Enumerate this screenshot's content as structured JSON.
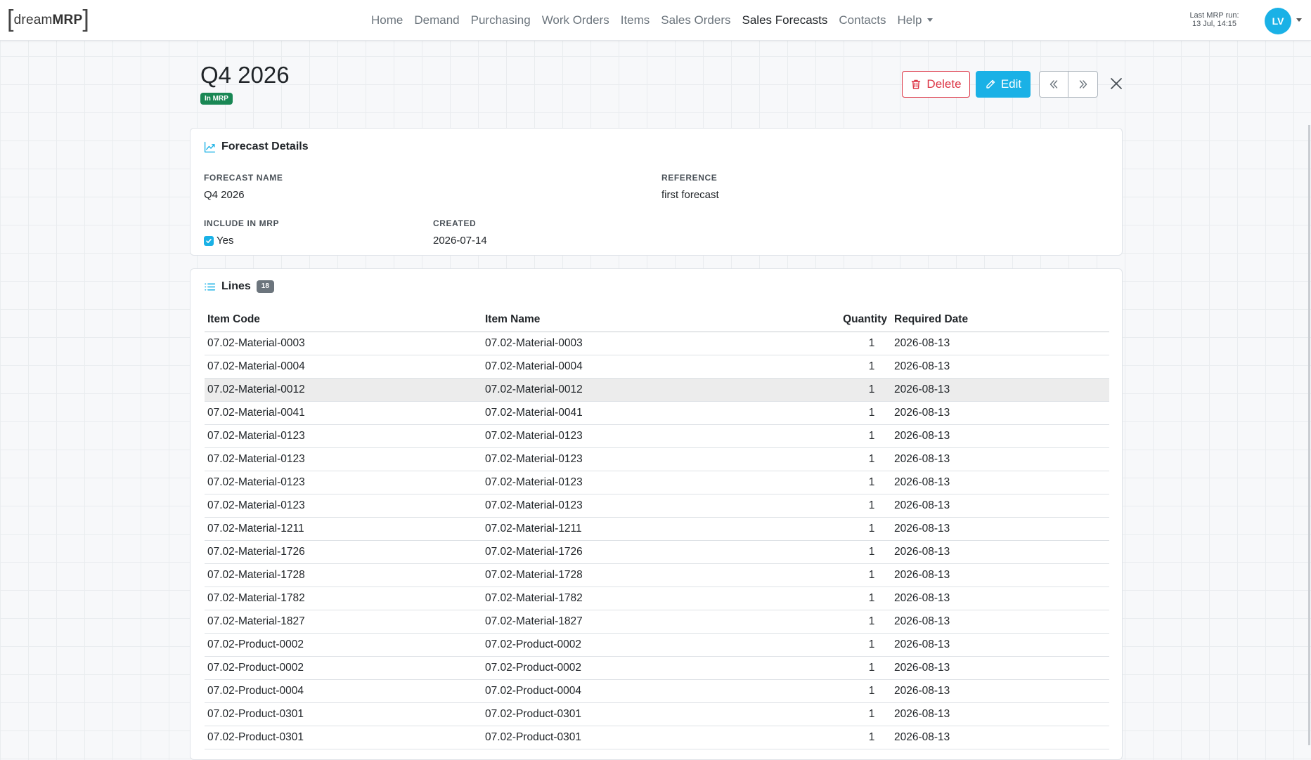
{
  "brand": {
    "left_bracket": "[",
    "light": "dream",
    "bold": "MRP",
    "right_bracket": "]"
  },
  "nav": {
    "links": [
      {
        "label": "Home",
        "active": false
      },
      {
        "label": "Demand",
        "active": false
      },
      {
        "label": "Purchasing",
        "active": false
      },
      {
        "label": "Work Orders",
        "active": false
      },
      {
        "label": "Items",
        "active": false
      },
      {
        "label": "Sales Orders",
        "active": false
      },
      {
        "label": "Sales Forecasts",
        "active": true
      },
      {
        "label": "Contacts",
        "active": false
      },
      {
        "label": "Help",
        "active": false
      }
    ],
    "last_mrp_label": "Last MRP run:",
    "last_mrp_value": "13 Jul, 14:15",
    "avatar_initials": "LV"
  },
  "header": {
    "title": "Q4 2026",
    "badge": "In MRP",
    "delete_label": "Delete",
    "edit_label": "Edit"
  },
  "details": {
    "title": "Forecast Details",
    "forecast_name_label": "FORECAST NAME",
    "forecast_name": "Q4 2026",
    "reference_label": "REFERENCE",
    "reference": "first forecast",
    "include_label": "INCLUDE IN MRP",
    "include_value": "Yes",
    "created_label": "CREATED",
    "created": "2026-07-14"
  },
  "lines": {
    "title": "Lines",
    "count": "18",
    "columns": {
      "code": "Item Code",
      "name": "Item Name",
      "qty": "Quantity",
      "date": "Required Date"
    },
    "rows": [
      {
        "code": "07.02-Material-0003",
        "name": "07.02-Material-0003",
        "qty": "1",
        "date": "2026-08-13"
      },
      {
        "code": "07.02-Material-0004",
        "name": "07.02-Material-0004",
        "qty": "1",
        "date": "2026-08-13"
      },
      {
        "code": "07.02-Material-0012",
        "name": "07.02-Material-0012",
        "qty": "1",
        "date": "2026-08-13"
      },
      {
        "code": "07.02-Material-0041",
        "name": "07.02-Material-0041",
        "qty": "1",
        "date": "2026-08-13"
      },
      {
        "code": "07.02-Material-0123",
        "name": "07.02-Material-0123",
        "qty": "1",
        "date": "2026-08-13"
      },
      {
        "code": "07.02-Material-0123",
        "name": "07.02-Material-0123",
        "qty": "1",
        "date": "2026-08-13"
      },
      {
        "code": "07.02-Material-0123",
        "name": "07.02-Material-0123",
        "qty": "1",
        "date": "2026-08-13"
      },
      {
        "code": "07.02-Material-0123",
        "name": "07.02-Material-0123",
        "qty": "1",
        "date": "2026-08-13"
      },
      {
        "code": "07.02-Material-1211",
        "name": "07.02-Material-1211",
        "qty": "1",
        "date": "2026-08-13"
      },
      {
        "code": "07.02-Material-1726",
        "name": "07.02-Material-1726",
        "qty": "1",
        "date": "2026-08-13"
      },
      {
        "code": "07.02-Material-1728",
        "name": "07.02-Material-1728",
        "qty": "1",
        "date": "2026-08-13"
      },
      {
        "code": "07.02-Material-1782",
        "name": "07.02-Material-1782",
        "qty": "1",
        "date": "2026-08-13"
      },
      {
        "code": "07.02-Material-1827",
        "name": "07.02-Material-1827",
        "qty": "1",
        "date": "2026-08-13"
      },
      {
        "code": "07.02-Product-0002",
        "name": "07.02-Product-0002",
        "qty": "1",
        "date": "2026-08-13"
      },
      {
        "code": "07.02-Product-0002",
        "name": "07.02-Product-0002",
        "qty": "1",
        "date": "2026-08-13"
      },
      {
        "code": "07.02-Product-0004",
        "name": "07.02-Product-0004",
        "qty": "1",
        "date": "2026-08-13"
      },
      {
        "code": "07.02-Product-0301",
        "name": "07.02-Product-0301",
        "qty": "1",
        "date": "2026-08-13"
      },
      {
        "code": "07.02-Product-0301",
        "name": "07.02-Product-0301",
        "qty": "1",
        "date": "2026-08-13"
      }
    ]
  },
  "colors": {
    "accent": "#1ab1e6",
    "danger": "#dc3545",
    "success": "#198754",
    "badge_gray": "#6c757d"
  },
  "icons": {
    "delete": "trash-icon",
    "edit": "pencil-icon",
    "prev": "chevrons-left-icon",
    "next": "chevrons-right-icon",
    "close": "close-icon",
    "details": "chart-line-icon",
    "lines": "list-icon"
  }
}
